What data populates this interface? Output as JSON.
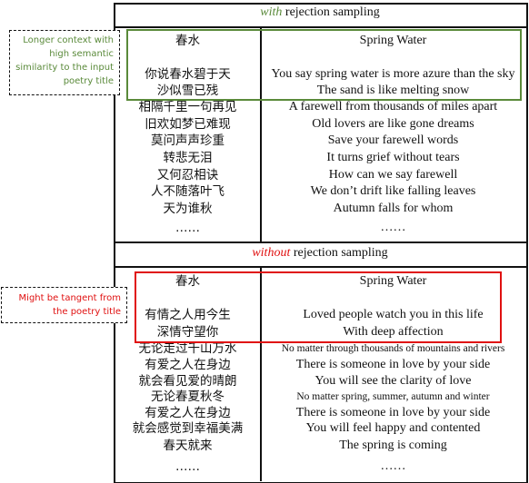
{
  "colors": {
    "green": "#5a8a3a",
    "red": "#e01010"
  },
  "sections": [
    {
      "header_em": "with",
      "header_rest": " rejection sampling",
      "header_color": "#5a8a3a",
      "title_zh": "春水",
      "title_en": "Spring Water",
      "lines_zh": [
        "你说春水碧于天",
        "沙似雪已残",
        "相隔千里一句再见",
        "旧欢如梦已难现",
        "莫问声声珍重",
        "转悲无泪",
        "又何忍相诀",
        "人不随落叶飞",
        "天为谁秋",
        "……"
      ],
      "lines_en": [
        "You say spring water is more azure than the sky",
        "The sand is like melting snow",
        "A farewell from thousands of miles apart",
        "Old lovers are like gone dreams",
        "Save your farewell words",
        "It turns grief without tears",
        "How can we say farewell",
        "We don’t drift like falling leaves",
        "Autumn falls for whom",
        "……"
      ],
      "note": "Longer context with high semantic similarity to the input poetry title"
    },
    {
      "header_em": "without",
      "header_rest": " rejection sampling",
      "header_color": "#e01010",
      "title_zh": "春水",
      "title_en": "Spring Water",
      "lines_zh": [
        "有情之人用今生",
        "深情守望你",
        "无论走过千山万水",
        "有爱之人在身边",
        "就会看见爱的晴朗",
        "无论春夏秋冬",
        "有爱之人在身边",
        "就会感觉到幸福美满",
        "春天就来",
        "……"
      ],
      "lines_en": [
        "Loved people watch you in this life",
        "With deep affection",
        "No matter through thousands of mountains and rivers",
        "There is someone in love by your side",
        "You will see the clarity of love",
        "No matter spring, summer, autumn and winter",
        "There is someone in love by your side",
        "You will feel happy and contented",
        "The spring is coming",
        "……"
      ],
      "note": "Might be tangent from the poetry title"
    }
  ]
}
